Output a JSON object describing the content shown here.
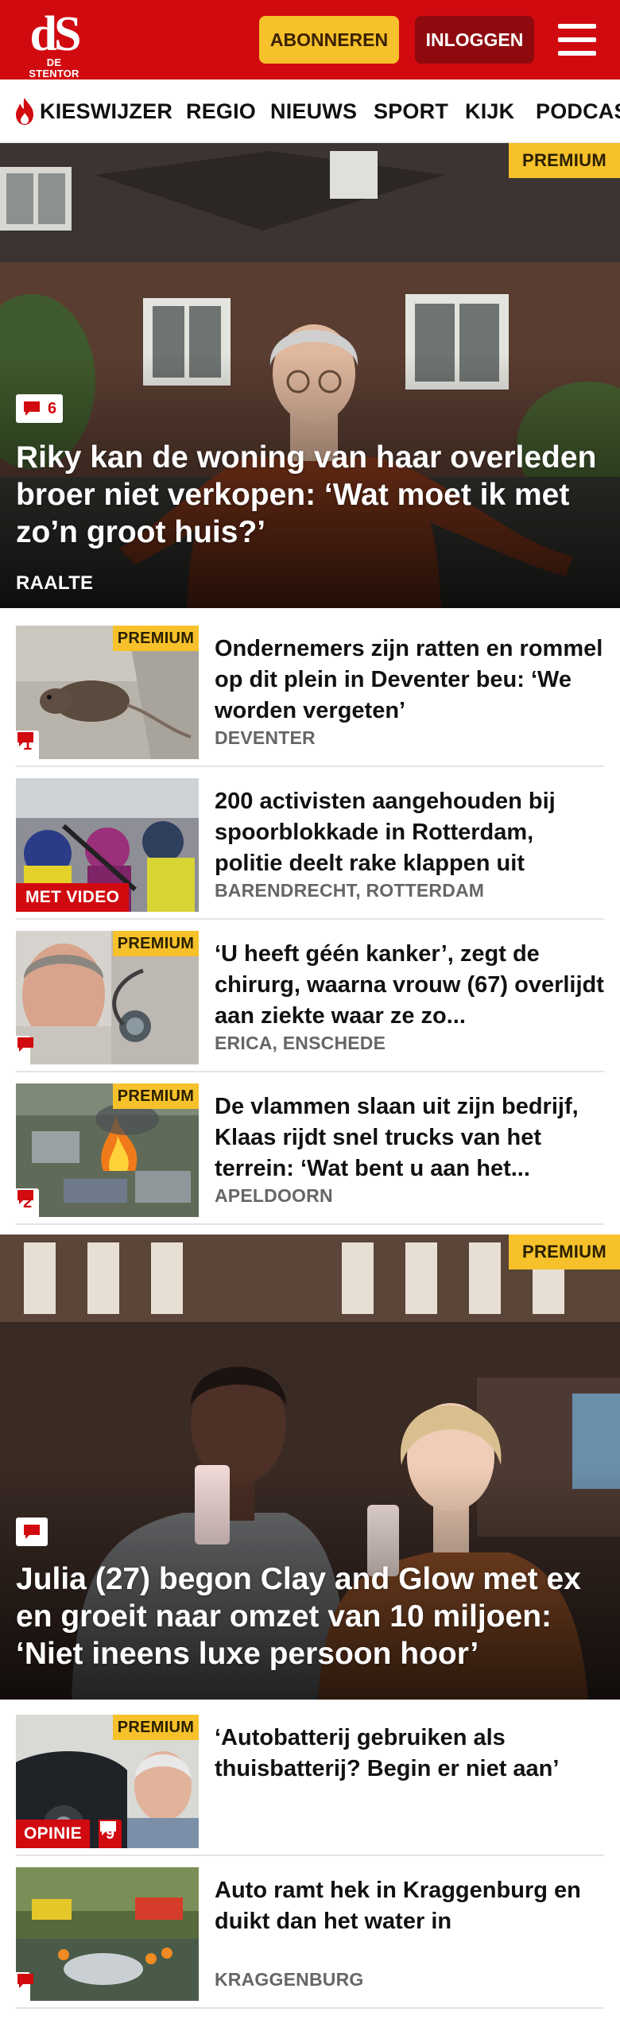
{
  "header": {
    "logo_mark": "dS",
    "logo_sub": "DE STENTOR",
    "subscribe_label": "ABONNEREN",
    "login_label": "INLOGGEN",
    "brand_color": "#d10a10",
    "accent_color": "#f6c12a"
  },
  "nav": {
    "items": [
      "KIESWIJZER",
      "REGIO",
      "NIEUWS",
      "SPORT",
      "KIJK",
      "PODCAS"
    ]
  },
  "hero1": {
    "badge": "PREMIUM",
    "comments": "6",
    "title": "Riky kan de woning van haar overleden broer niet verkopen: ‘Wat moet ik met zo’n groot huis?’",
    "region": "RAALTE"
  },
  "articles": [
    {
      "badge": "PREMIUM",
      "comments": "1",
      "title": "Ondernemers zijn ratten en rommel op dit plein in Deventer beu: ‘We worden vergeten’",
      "region": "DEVENTER"
    },
    {
      "label": "MET VIDEO",
      "title": "200 activisten aangehouden bij spoorblokkade in Rotterdam, politie deelt rake klappen uit",
      "region": "BARENDRECHT, ROTTERDAM"
    },
    {
      "badge": "PREMIUM",
      "title": "‘U heeft géén kanker’, zegt de chirurg, waarna vrouw (67) overlijdt aan ziekte waar ze zo...",
      "region": "ERICA, ENSCHEDE"
    },
    {
      "badge": "PREMIUM",
      "comments": "2",
      "title": "De vlammen slaan uit zijn bedrijf, Klaas rijdt snel trucks van het terrein: ‘Wat bent u aan het...",
      "region": "APELDOORN"
    }
  ],
  "hero2": {
    "badge": "PREMIUM",
    "title": "Julia (27) begon Clay and Glow met ex en groeit naar omzet van 10 miljoen: ‘Niet ineens luxe persoon hoor’"
  },
  "articles2": [
    {
      "badge": "PREMIUM",
      "label": "OPINIE",
      "comments": "9",
      "title": "‘Autobatterij gebruiken als thuisbatterij? Begin er niet aan’",
      "region": ""
    },
    {
      "title": "Auto ramt hek in Kraggenburg en duikt dan het water in",
      "region": "KRAGGENBURG"
    }
  ]
}
